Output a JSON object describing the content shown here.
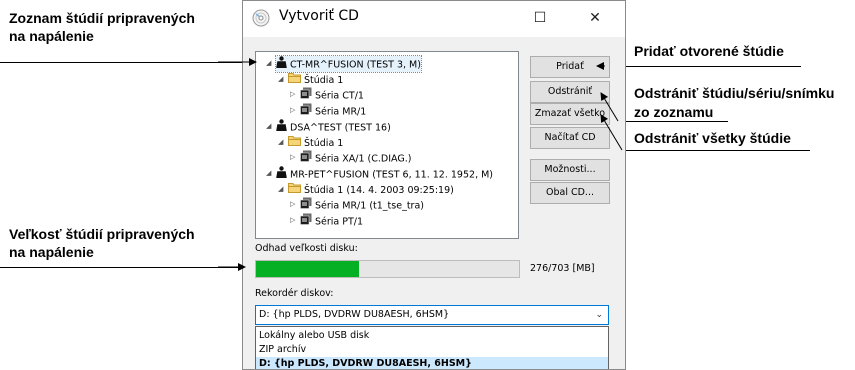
{
  "annotations": {
    "list_studies": [
      "Zoznam štúdií pripravených",
      "na napálenie"
    ],
    "size_studies": [
      "Veľkosť štúdií pripravených",
      "na napálenie"
    ],
    "add_open": "Pridať otvorené štúdie",
    "remove_item": [
      "Odstrániť štúdiu/sériu/snímku",
      "zo zoznamu"
    ],
    "remove_all": "Odstrániť všetky štúdie"
  },
  "window": {
    "title": "Vytvoriť CD",
    "minimize_glyph": "☐",
    "close_glyph": "✕"
  },
  "tree": [
    {
      "level": 0,
      "icon": "person-icon",
      "label": "CT-MR^FUSION (TEST 3, M)",
      "expanded": true,
      "selected": true
    },
    {
      "level": 1,
      "icon": "folder-icon",
      "label": "Štúdia 1",
      "expanded": true
    },
    {
      "level": 2,
      "icon": "series-icon",
      "label": "Séria CT/1",
      "expanded": false
    },
    {
      "level": 2,
      "icon": "series-icon",
      "label": "Séria MR/1",
      "expanded": false
    },
    {
      "level": 0,
      "icon": "person-icon",
      "label": "DSA^TEST (TEST 16)",
      "expanded": true
    },
    {
      "level": 1,
      "icon": "folder-icon",
      "label": "Štúdia 1",
      "expanded": true
    },
    {
      "level": 2,
      "icon": "series-icon",
      "label": "Séria XA/1 (C.DIAG.)",
      "expanded": false
    },
    {
      "level": 0,
      "icon": "person-icon",
      "label": "MR-PET^FUSION (TEST 6, 11. 12. 1952, M)",
      "expanded": true
    },
    {
      "level": 1,
      "icon": "folder-icon",
      "label": "Štúdia 1 (14. 4. 2003 09:25:19)",
      "expanded": true
    },
    {
      "level": 2,
      "icon": "series-icon",
      "label": "Séria MR/1 (t1_tse_tra)",
      "expanded": false
    },
    {
      "level": 2,
      "icon": "series-icon",
      "label": "Séria PT/1",
      "expanded": false
    }
  ],
  "buttons": {
    "add": "Pridať",
    "remove": "Odstrániť",
    "remove_all": "Zmazať všetko",
    "load": "Načítať CD",
    "options": "Možnosti...",
    "cover": "Obal CD..."
  },
  "disk": {
    "label": "Odhad veľkosti disku:",
    "used": 276,
    "capacity": 703,
    "text": "276/703 [MB]",
    "bar_color": "#06b025"
  },
  "recorder": {
    "label": "Rekordér diskov:",
    "selected": "D: {hp PLDS, DVDRW  DU8AESH, 6HSM}",
    "options": [
      "Lokálny alebo USB disk",
      "ZIP archív",
      "D: {hp PLDS, DVDRW  DU8AESH, 6HSM}"
    ]
  }
}
